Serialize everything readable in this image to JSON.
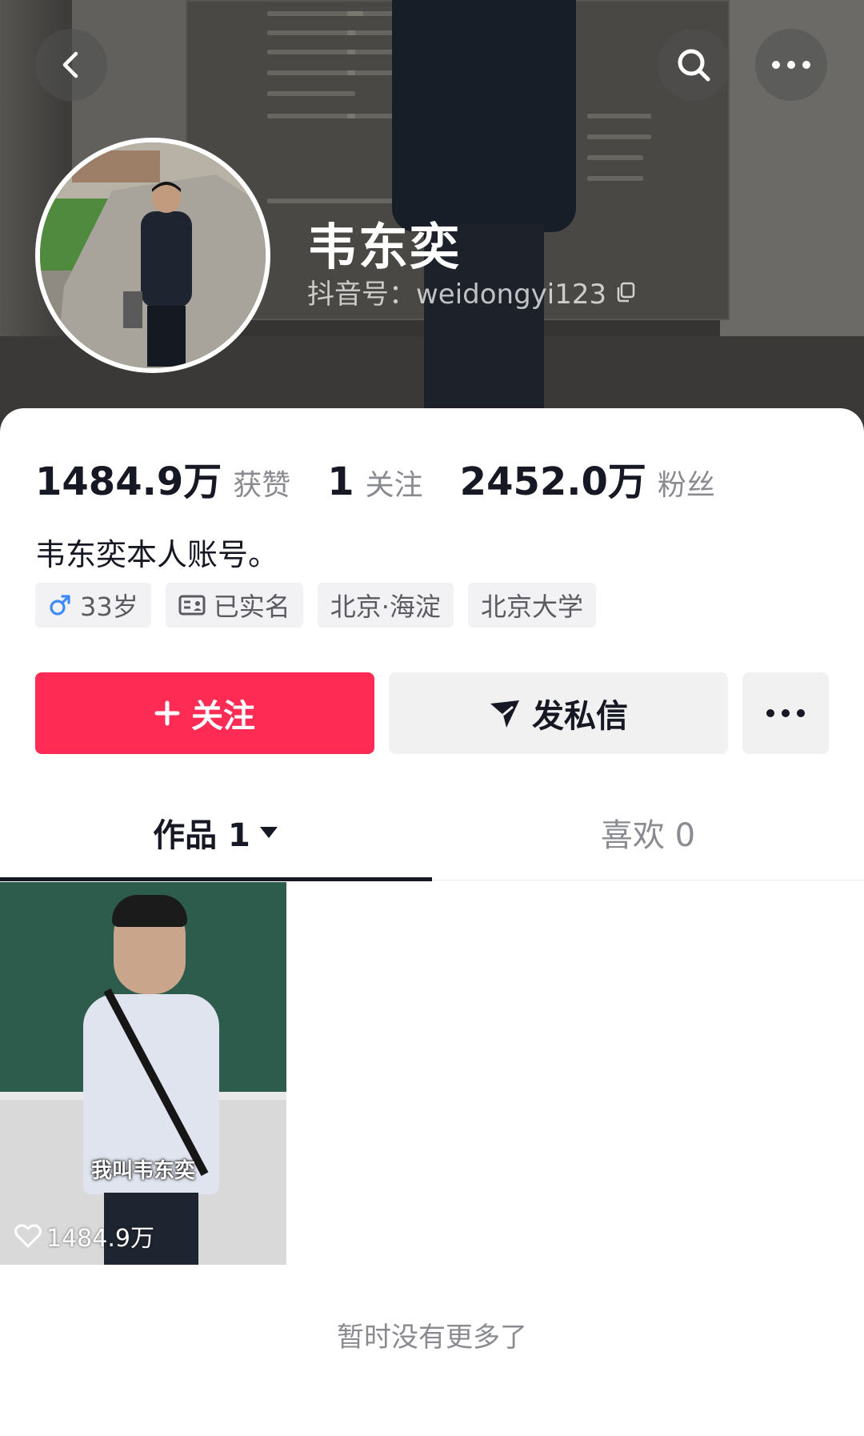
{
  "profile": {
    "nickname": "韦东奕",
    "handle": "抖音号：weidongyi123",
    "bio": "韦东奕本人账号。"
  },
  "stats": [
    {
      "value": "1484.9万",
      "label": "获赞"
    },
    {
      "value": "1",
      "label": "关注"
    },
    {
      "value": "2452.0万",
      "label": "粉丝"
    }
  ],
  "tags": [
    {
      "icon": "male-icon",
      "label": "33岁"
    },
    {
      "icon": "id-card-icon",
      "label": "已实名"
    },
    {
      "label": "北京·海淀"
    },
    {
      "label": "北京大学"
    }
  ],
  "actions": {
    "follow": "关注",
    "message": "发私信"
  },
  "tabs": [
    {
      "label": "作品 1"
    },
    {
      "label": "喜欢 0"
    }
  ],
  "videos": [
    {
      "caption": "我叫韦东奕",
      "likes": "1484.9万"
    }
  ],
  "footer": {
    "no_more": "暂时没有更多了"
  },
  "colors": {
    "accent": "#fe2c55",
    "text_primary": "#161823",
    "text_secondary": "#8a8b91"
  }
}
